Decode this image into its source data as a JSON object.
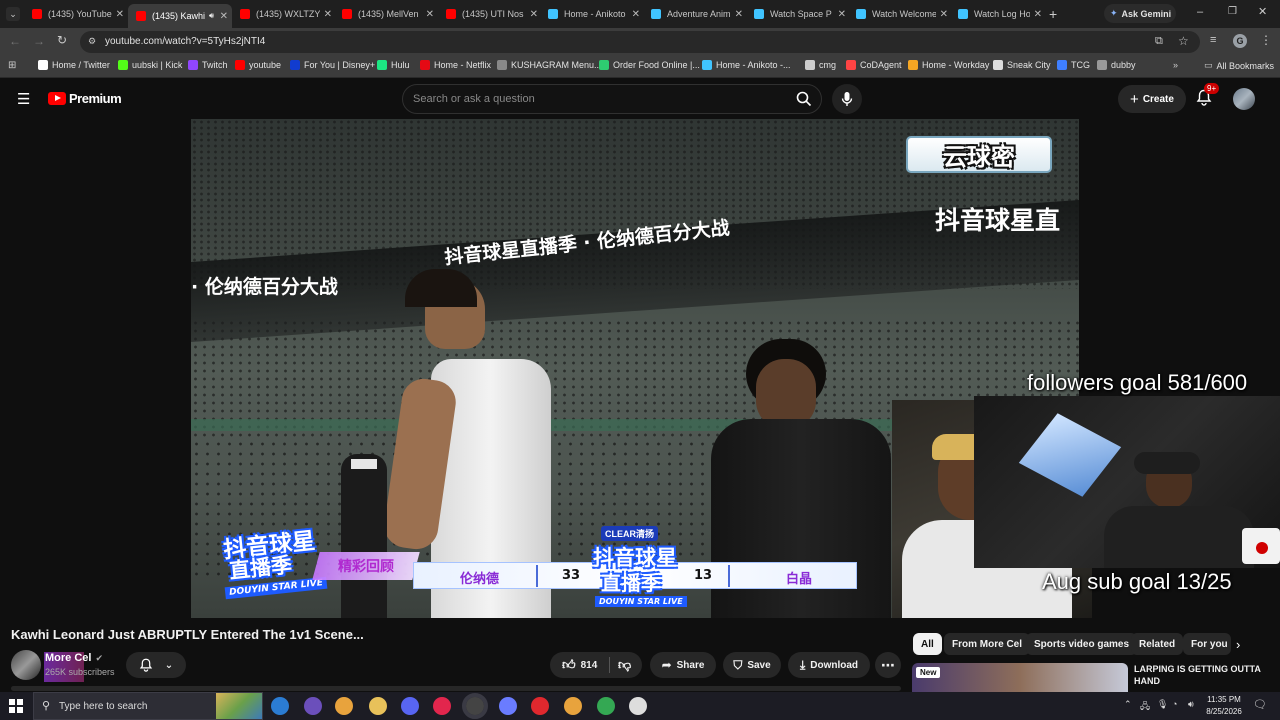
{
  "browser": {
    "tabs": [
      {
        "label": "(1435) YouTube",
        "color": "#ff0000"
      },
      {
        "label": "(1435) Kawhi",
        "color": "#ff0000"
      },
      {
        "label": "(1435) WXLTZY",
        "color": "#ff0000"
      },
      {
        "label": "(1435) MellVen",
        "color": "#ff0000"
      },
      {
        "label": "(1435) UTI Nos",
        "color": "#ff0000"
      },
      {
        "label": "Home - Anikoto",
        "color": "#40c4ff"
      },
      {
        "label": "Adventure Anim",
        "color": "#40c4ff"
      },
      {
        "label": "Watch Space P",
        "color": "#40c4ff"
      },
      {
        "label": "Watch Welcome",
        "color": "#40c4ff"
      },
      {
        "label": "Watch Log Hor",
        "color": "#40c4ff"
      }
    ],
    "ask_gemini": "Ask Gemini",
    "url": "youtube.com/watch?v=5TyHs2jNTI4",
    "profile_initial": "G",
    "bookmarks": [
      {
        "label": "Home / Twitter",
        "color": "#ffffff"
      },
      {
        "label": "uubski | Kick",
        "color": "#53fc18"
      },
      {
        "label": "Twitch",
        "color": "#9146ff"
      },
      {
        "label": "youtube",
        "color": "#ff0000"
      },
      {
        "label": "For You | Disney+",
        "color": "#113ccf"
      },
      {
        "label": "Hulu",
        "color": "#1ce783"
      },
      {
        "label": "Home - Netflix",
        "color": "#e50914"
      },
      {
        "label": "KUSHAGRAM Menu...",
        "color": "#888888"
      },
      {
        "label": "Order Food Online |...",
        "color": "#2ecc71"
      },
      {
        "label": "Home - Anikoto -...",
        "color": "#40c4ff"
      },
      {
        "label": "cmg",
        "color": "#cccccc"
      },
      {
        "label": "CoDAgent",
        "color": "#ff4444"
      },
      {
        "label": "Home - Workday",
        "color": "#f5a623"
      },
      {
        "label": "Sneak City",
        "color": "#dddddd"
      },
      {
        "label": "TCG",
        "color": "#3f7fff"
      },
      {
        "label": "dubby",
        "color": "#999999"
      }
    ],
    "all_bookmarks": "All Bookmarks"
  },
  "youtube": {
    "logo": "Premium",
    "search_placeholder": "Search or ask a question",
    "create_label": "Create",
    "notif_badge": "9+",
    "video_overlay": {
      "top_logo": "云球密",
      "banner_main": "抖音球星直播季 · 伦纳德百分大战",
      "banner_left": "· 伦纳德百分大战",
      "banner_right": "抖音球星直",
      "brand_left_1": "抖音球星",
      "brand_left_2": "直播季",
      "brand_sub": "DOUYIN STAR LIVE",
      "replay_label": "精彩回顾",
      "sponsor": "CLEAR清扬",
      "team_home": "伦纳德",
      "score_home": "33",
      "score_away": "13",
      "team_away": "白晶"
    },
    "stream_overlay": {
      "followers_goal": "followers goal 581/600",
      "sub_goal": "Aug sub goal 13/25"
    },
    "video_title": "Kawhi Leonard Just ABRUPTLY Entered The 1v1 Scene...",
    "channel": {
      "name": "More Cel",
      "subscribers": "265K subscribers"
    },
    "actions": {
      "likes": "814",
      "share": "Share",
      "save": "Save",
      "download": "Download"
    },
    "chips": [
      "All",
      "From More Cel",
      "Sports video games",
      "Related",
      "For you"
    ],
    "sidebar_video": {
      "badge": "New",
      "title": "LARPING IS GETTING OUTTA HAND"
    }
  },
  "taskbar": {
    "search_placeholder": "Type here to search",
    "time": "11:35 PM",
    "date": "8/25/2026"
  }
}
